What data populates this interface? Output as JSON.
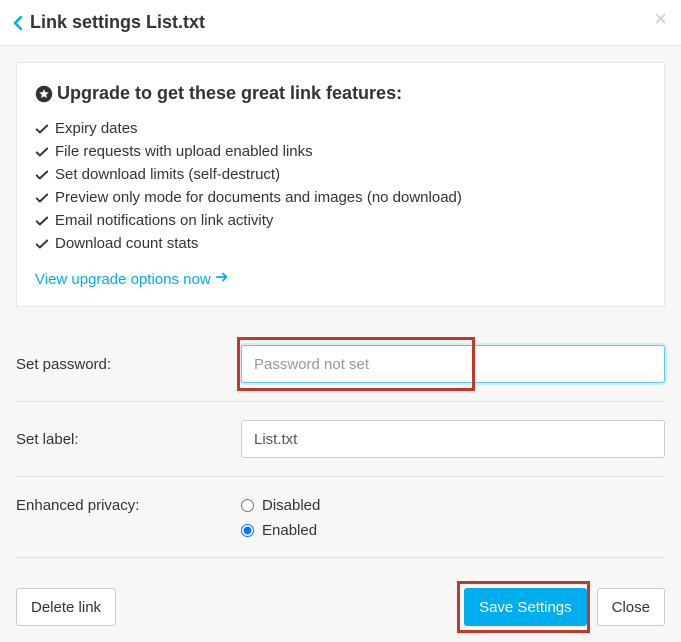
{
  "header": {
    "title": "Link settings List.txt"
  },
  "upgrade": {
    "heading": "Upgrade to get these great link features:",
    "features": [
      "Expiry dates",
      "File requests with upload enabled links",
      "Set download limits (self-destruct)",
      "Preview only mode for documents and images (no download)",
      "Email notifications on link activity",
      "Download count stats"
    ],
    "link_text": "View upgrade options now"
  },
  "form": {
    "password_label": "Set password:",
    "password_placeholder": "Password not set",
    "password_value": "",
    "label_label": "Set label:",
    "label_value": "List.txt",
    "privacy_label": "Enhanced privacy:",
    "privacy_options": {
      "disabled": "Disabled",
      "enabled": "Enabled"
    },
    "privacy_selected": "enabled"
  },
  "buttons": {
    "delete": "Delete link",
    "save": "Save Settings",
    "close": "Close"
  }
}
